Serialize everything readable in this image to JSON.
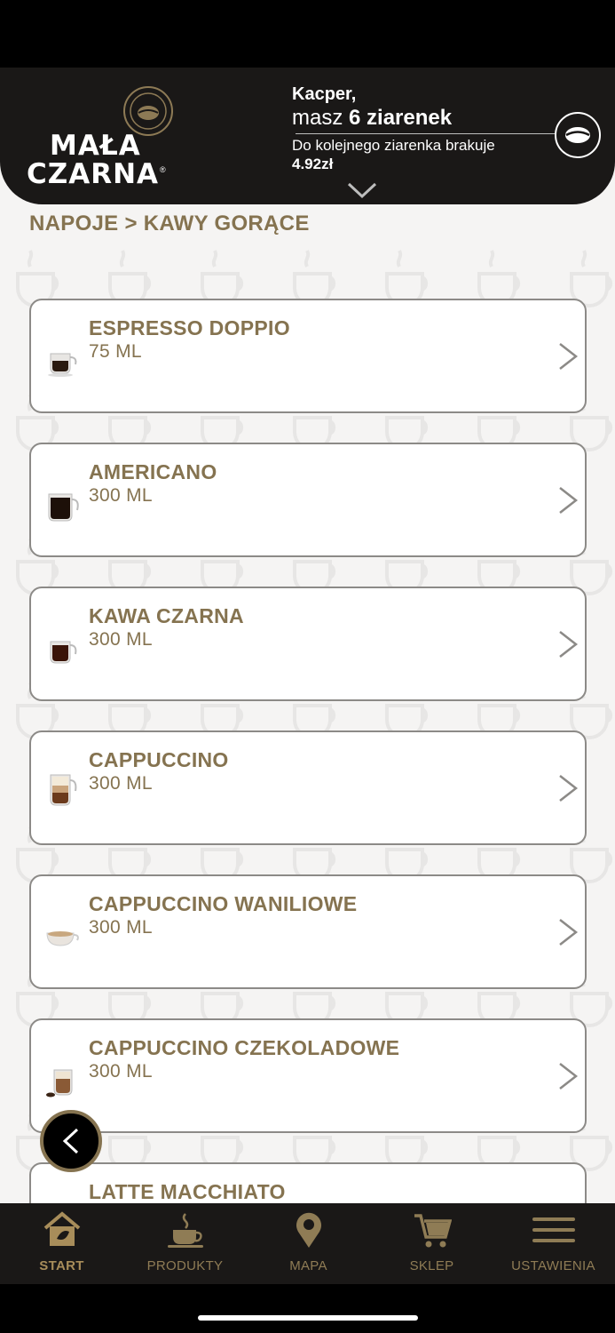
{
  "header": {
    "logo_line1": "MAŁA",
    "logo_line2": "CZARNA",
    "logo_reg": "®",
    "user_name": "Kacper,",
    "beans_prefix": "masz ",
    "beans_count": "6 ziarenek",
    "missing_label": "Do kolejnego ziarenka brakuje",
    "missing_amount": "4.92zł"
  },
  "breadcrumb": "NAPOJE > KAWY GORĄCE",
  "products": [
    {
      "name": "ESPRESSO DOPPIO",
      "volume": "75 ML"
    },
    {
      "name": "AMERICANO",
      "volume": "300 ML"
    },
    {
      "name": "KAWA CZARNA",
      "volume": "300 ML"
    },
    {
      "name": "CAPPUCCINO",
      "volume": "300 ML"
    },
    {
      "name": "CAPPUCCINO WANILIOWE",
      "volume": "300 ML"
    },
    {
      "name": "CAPPUCCINO CZEKOLADOWE",
      "volume": "300 ML"
    },
    {
      "name": "LATTE MACCHIATO",
      "volume": ""
    }
  ],
  "tabs": [
    {
      "label": "START",
      "icon": "home-icon",
      "active": true
    },
    {
      "label": "PRODUKTY",
      "icon": "coffee-cup-icon",
      "active": false
    },
    {
      "label": "MAPA",
      "icon": "map-pin-icon",
      "active": false
    },
    {
      "label": "SKLEP",
      "icon": "cart-icon",
      "active": false
    },
    {
      "label": "USTAWIENIA",
      "icon": "menu-icon",
      "active": false
    }
  ],
  "colors": {
    "accent": "#857350",
    "header_bg": "#1a1817",
    "card_border": "#8c8a87",
    "screen_bg": "#f5f4f3"
  }
}
